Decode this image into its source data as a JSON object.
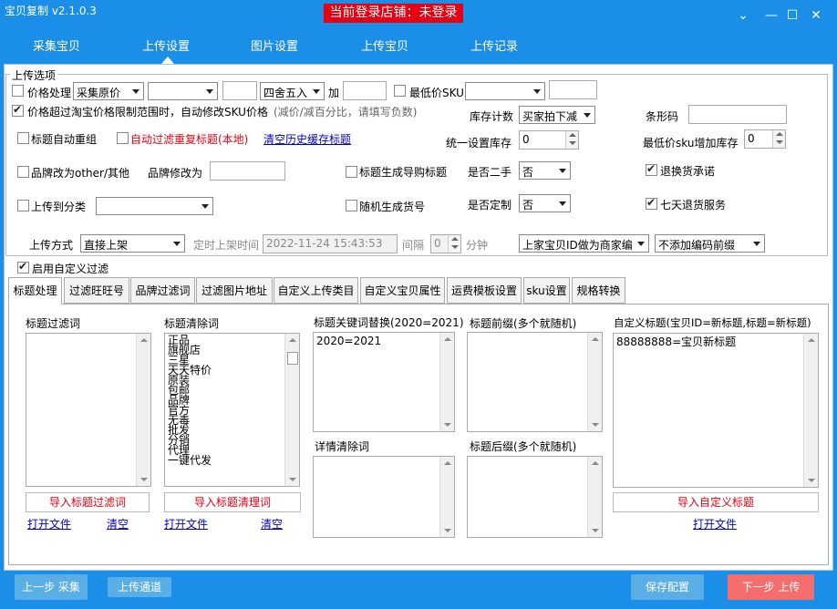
{
  "app": {
    "title": "宝贝复制 v2.1.0.3",
    "store_status": "当前登录店铺：未登录"
  },
  "window_controls": {
    "menu": "⌄",
    "minimize": "—",
    "maximize": "☐",
    "close": "✕"
  },
  "nav": {
    "items": [
      "采集宝贝",
      "上传设置",
      "图片设置",
      "上传宝贝",
      "上传记录"
    ],
    "active": "上传设置"
  },
  "upload_options": {
    "legend": "上传选项",
    "price_processing": {
      "label": "价格处理",
      "checked": false,
      "source": "采集原价",
      "op": "",
      "value": "",
      "rounding": "四舍五入",
      "add_label": "加",
      "add_value": ""
    },
    "lowest_sku": {
      "label": "最低价SKU",
      "checked": false,
      "select": "",
      "value": ""
    },
    "auto_fix_sku": {
      "label": "价格超过淘宝价格限制范围时，自动修改SKU价格",
      "checked": true,
      "hint": "(减价/减百分比，请填写负数)"
    },
    "inventory_count": {
      "label": "库存计数",
      "value": "买家拍下减"
    },
    "barcode": {
      "label": "条形码",
      "value": ""
    },
    "title_regroup": {
      "label": "标题自动重组",
      "checked": false
    },
    "filter_dup_title": {
      "label": "自动过滤重复标题(本地)",
      "checked": false
    },
    "clear_history": "清空历史缓存标题",
    "unified_stock": {
      "label": "统一设置库存",
      "value": "0"
    },
    "min_sku_stock": {
      "label": "最低价sku增加库存",
      "value": "0"
    },
    "brand_other": {
      "label": "品牌改为other/其他",
      "checked": false
    },
    "brand_change": {
      "label": "品牌修改为",
      "value": ""
    },
    "title_guide": {
      "label": "标题生成导购标题",
      "checked": false
    },
    "second_hand": {
      "label": "是否二手",
      "value": "否"
    },
    "return_promise": {
      "label": "退换货承诺",
      "checked": true
    },
    "upload_category": {
      "label": "上传到分类",
      "checked": false,
      "value": ""
    },
    "random_sku_no": {
      "label": "随机生成货号",
      "checked": false
    },
    "customized": {
      "label": "是否定制",
      "value": "否"
    },
    "seven_day": {
      "label": "七天退货服务",
      "checked": true
    },
    "upload_method": {
      "label": "上传方式",
      "value": "直接上架"
    },
    "scheduled": {
      "label": "定时上架时间",
      "datetime": "2022-11-24 15:43:53",
      "interval_label": "间隔",
      "interval_value": "0",
      "unit": "分钟"
    },
    "merchant_code": {
      "value": "上家宝贝ID做为商家编"
    },
    "code_prefix": {
      "value": "不添加编码前缀"
    }
  },
  "enable_custom_filter": {
    "label": "启用自定义过滤",
    "checked": true
  },
  "tabs": [
    "标题处理",
    "过滤旺旺号",
    "品牌过滤词",
    "过滤图片地址",
    "自定义上传类目",
    "自定义宝贝属性",
    "运费模板设置",
    "sku设置",
    "规格转换"
  ],
  "active_tab": "标题处理",
  "title_panel": {
    "filter_words": {
      "label": "标题过滤词",
      "items": [],
      "import": "导入标题过滤词",
      "open": "打开文件",
      "clear": "清空"
    },
    "clear_words": {
      "label": "标题清除词",
      "items": [
        "正品",
        "旗舰店",
        "三星",
        "天天特价",
        "原装",
        "包邮",
        "品牌",
        "官方",
        "无毒",
        "批发",
        "分销",
        "代理",
        "一键代发"
      ],
      "import": "导入标题清理词",
      "open": "打开文件",
      "clear": "清空"
    },
    "replace": {
      "label": "标题关键词替换(2020=2021)",
      "text": "2020=2021"
    },
    "detail_clear": {
      "label": "详情清除词",
      "text": ""
    },
    "prefix": {
      "label": "标题前缀(多个就随机)",
      "text": ""
    },
    "suffix": {
      "label": "标题后缀(多个就随机)",
      "text": ""
    },
    "custom_title": {
      "label": "自定义标题(宝贝ID=新标题,标题=新标题)",
      "text": "88888888=宝贝新标题",
      "import": "导入自定义标题",
      "open": "打开文件"
    }
  },
  "footer": {
    "prev": "上一步 采集",
    "channel": "上传通道",
    "save": "保存配置",
    "next": "下一步 上传"
  },
  "colors": {
    "brand_blue": "#1b8ee8",
    "red": "#e60012",
    "button_blue": "#5aaee6",
    "button_red": "#f56d6d"
  }
}
